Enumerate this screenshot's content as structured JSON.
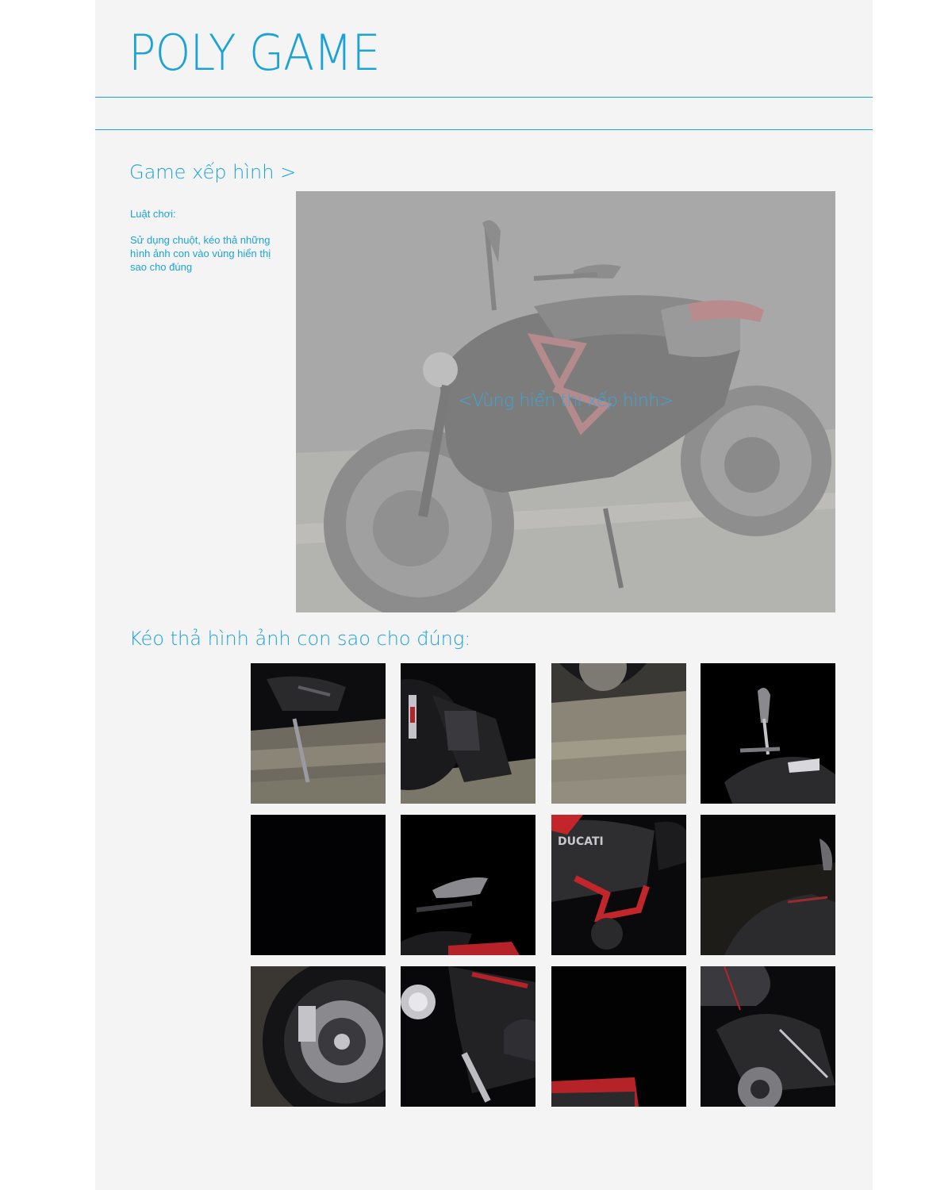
{
  "header": {
    "title": "POLY GAME"
  },
  "game": {
    "heading": "Game xếp hình >",
    "rules_title": "Luật chơi:",
    "rules_text": "Sử dụng chuột, kéo thả những hình ảnh con vào vùng hiển thị sao cho đúng",
    "board_label": "<Vùng hiển thị xếp hình>",
    "board_image_icon": "motorcycle-image",
    "pieces_heading": "Kéo thả hình ảnh con sao cho đúng:",
    "pieces": [
      {
        "icon": "kickstand-piece-image"
      },
      {
        "icon": "front-radiator-piece-image"
      },
      {
        "icon": "rear-wheel-pavement-piece-image"
      },
      {
        "icon": "mirror-handlebar-piece-image"
      },
      {
        "icon": "dark-empty-piece-image"
      },
      {
        "icon": "mirror-red-tank-piece-image"
      },
      {
        "icon": "ducati-tank-red-frame-piece-image"
      },
      {
        "icon": "front-fender-dark-piece-image"
      },
      {
        "icon": "front-wheel-brake-piece-image"
      },
      {
        "icon": "headlight-piece-image"
      },
      {
        "icon": "red-seat-edge-piece-image"
      },
      {
        "icon": "rear-swingarm-piece-image"
      }
    ]
  },
  "colors": {
    "accent": "#1ba3d8",
    "page_bg": "#f4f4f4",
    "board_bg": "#a9a9a9",
    "ducati_red": "#c2262b"
  }
}
